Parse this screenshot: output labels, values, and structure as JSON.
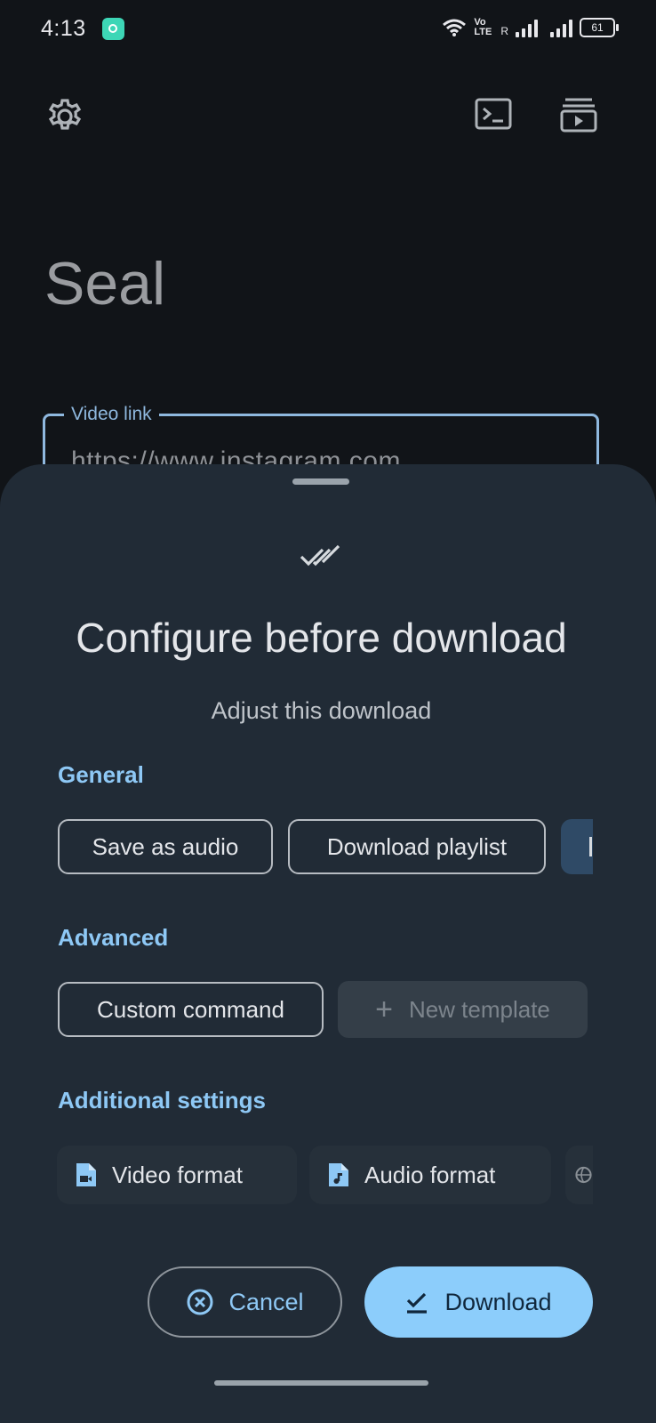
{
  "status_bar": {
    "time": "4:13",
    "volte": "Vo LTE",
    "roaming": "R",
    "battery": "61"
  },
  "app": {
    "title": "Seal",
    "icons": [
      "gear-icon",
      "terminal-icon",
      "playlist-icon"
    ]
  },
  "video_link": {
    "label": "Video link",
    "value": "https://www.instagram.com"
  },
  "sheet": {
    "title": "Configure before download",
    "subtitle": "Adjust this download",
    "general": {
      "heading": "General",
      "chips": [
        "Save as audio",
        "Download playlist"
      ]
    },
    "advanced": {
      "heading": "Advanced",
      "custom_command": "Custom command",
      "new_template": "New template"
    },
    "additional": {
      "heading": "Additional settings",
      "video_format": "Video format",
      "audio_format": "Audio format"
    },
    "buttons": {
      "cancel": "Cancel",
      "download": "Download"
    }
  },
  "colors": {
    "accent": "#8ec8f5",
    "primary_button": "#8ccdfb",
    "sheet_bg": "#212b36",
    "background": "#111418"
  }
}
